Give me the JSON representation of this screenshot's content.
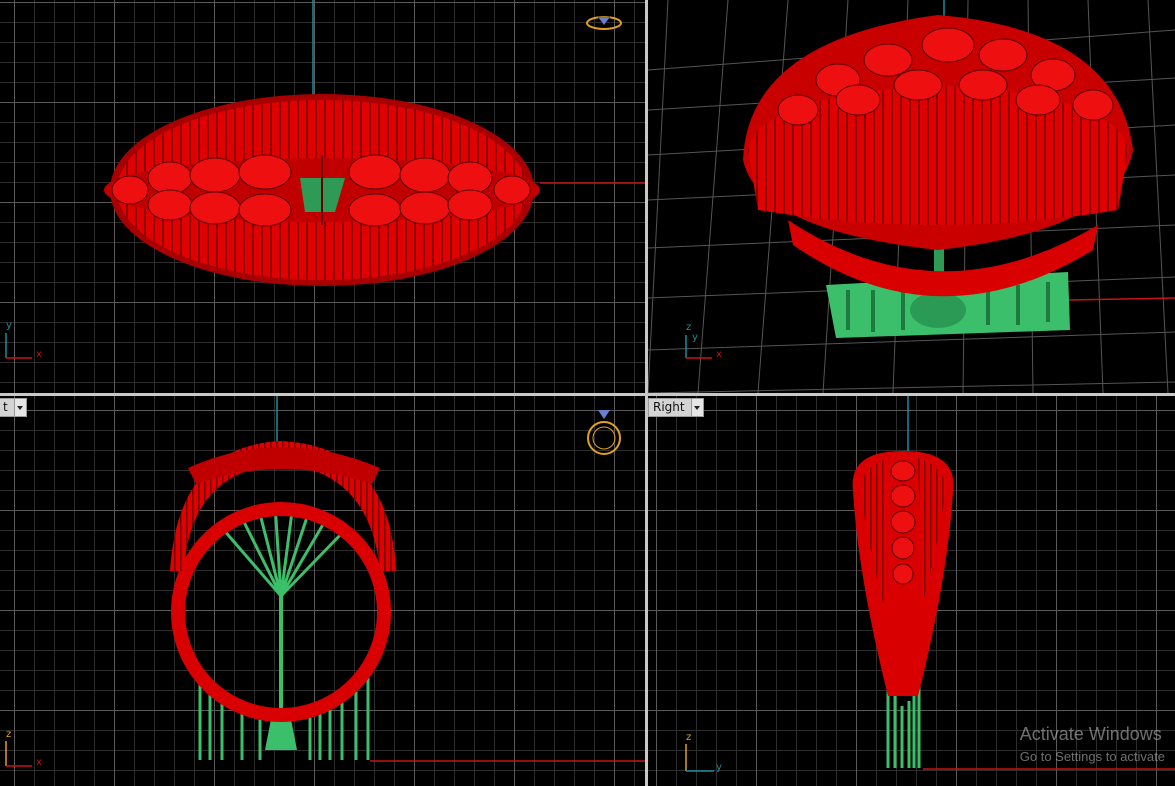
{
  "viewports": {
    "top": {
      "axis_x": "x",
      "axis_y": "y"
    },
    "perspective": {
      "axis_x": "x",
      "axis_y": "y",
      "axis_z": "z"
    },
    "front": {
      "label": "t",
      "axis_x": "x",
      "axis_z": "z"
    },
    "right": {
      "label": "Right",
      "axis_y": "y",
      "axis_z": "z"
    }
  },
  "colors": {
    "model_red": "#e00000",
    "support_green": "#3cbf6a",
    "axis_x_red": "#c81414",
    "axis_y_teal": "#1e8c9a",
    "grid_major": "#5a5a5a",
    "grid_minor": "#2d2d2d"
  },
  "icons": [
    "ring-top-icon",
    "ring-front-icon",
    "dropdown-arrow-icon"
  ],
  "watermark": {
    "title": "Activate Windows",
    "subtitle": "Go to Settings to activate"
  }
}
